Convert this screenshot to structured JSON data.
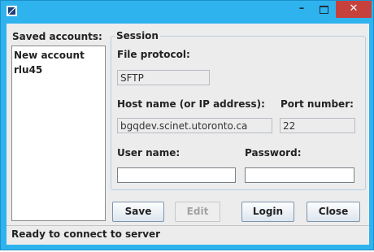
{
  "window": {
    "title": "",
    "controls": {
      "minimize": "–",
      "close": "✕"
    }
  },
  "accounts": {
    "label": "Saved accounts:",
    "items": [
      "New account",
      "rlu45"
    ]
  },
  "session": {
    "title": "Session",
    "protocol_label": "File protocol:",
    "protocol_value": "SFTP",
    "host_label": "Host name (or IP address):",
    "host_value": "bgqdev.scinet.utoronto.ca",
    "port_label": "Port number:",
    "port_value": "22",
    "user_label": "User name:",
    "user_value": "",
    "password_label": "Password:",
    "password_value": ""
  },
  "buttons": {
    "save": "Save",
    "edit": "Edit",
    "login": "Login",
    "close": "Close"
  },
  "status": {
    "text": "Ready to connect to server"
  },
  "colors": {
    "titlebar": "#2fb3ee",
    "close_button": "#c7413c",
    "panel": "#ececec"
  }
}
